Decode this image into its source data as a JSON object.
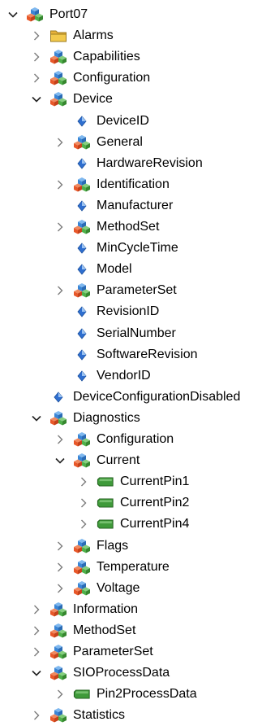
{
  "tree": {
    "rows": [
      {
        "label": "Port07",
        "depth": 0,
        "expander": "expanded",
        "icon": "object-icon"
      },
      {
        "label": "Alarms",
        "depth": 1,
        "expander": "collapsed",
        "icon": "folder-icon"
      },
      {
        "label": "Capabilities",
        "depth": 1,
        "expander": "collapsed",
        "icon": "object-icon"
      },
      {
        "label": "Configuration",
        "depth": 1,
        "expander": "collapsed",
        "icon": "object-icon"
      },
      {
        "label": "Device",
        "depth": 1,
        "expander": "expanded",
        "icon": "object-icon"
      },
      {
        "label": "DeviceID",
        "depth": 2,
        "expander": "none",
        "icon": "property-icon"
      },
      {
        "label": "General",
        "depth": 2,
        "expander": "collapsed",
        "icon": "object-icon"
      },
      {
        "label": "HardwareRevision",
        "depth": 2,
        "expander": "none",
        "icon": "property-icon"
      },
      {
        "label": "Identification",
        "depth": 2,
        "expander": "collapsed",
        "icon": "object-icon"
      },
      {
        "label": "Manufacturer",
        "depth": 2,
        "expander": "none",
        "icon": "property-icon"
      },
      {
        "label": "MethodSet",
        "depth": 2,
        "expander": "collapsed",
        "icon": "object-icon"
      },
      {
        "label": "MinCycleTime",
        "depth": 2,
        "expander": "none",
        "icon": "property-icon"
      },
      {
        "label": "Model",
        "depth": 2,
        "expander": "none",
        "icon": "property-icon"
      },
      {
        "label": "ParameterSet",
        "depth": 2,
        "expander": "collapsed",
        "icon": "object-icon"
      },
      {
        "label": "RevisionID",
        "depth": 2,
        "expander": "none",
        "icon": "property-icon"
      },
      {
        "label": "SerialNumber",
        "depth": 2,
        "expander": "none",
        "icon": "property-icon"
      },
      {
        "label": "SoftwareRevision",
        "depth": 2,
        "expander": "none",
        "icon": "property-icon"
      },
      {
        "label": "VendorID",
        "depth": 2,
        "expander": "none",
        "icon": "property-icon"
      },
      {
        "label": "DeviceConfigurationDisabled",
        "depth": 1,
        "expander": "none",
        "icon": "property-icon"
      },
      {
        "label": "Diagnostics",
        "depth": 1,
        "expander": "expanded",
        "icon": "object-icon"
      },
      {
        "label": "Configuration",
        "depth": 2,
        "expander": "collapsed",
        "icon": "object-icon"
      },
      {
        "label": "Current",
        "depth": 2,
        "expander": "expanded",
        "icon": "object-icon"
      },
      {
        "label": "CurrentPin1",
        "depth": 3,
        "expander": "collapsed",
        "icon": "variable-icon"
      },
      {
        "label": "CurrentPin2",
        "depth": 3,
        "expander": "collapsed",
        "icon": "variable-icon"
      },
      {
        "label": "CurrentPin4",
        "depth": 3,
        "expander": "collapsed",
        "icon": "variable-icon"
      },
      {
        "label": "Flags",
        "depth": 2,
        "expander": "collapsed",
        "icon": "object-icon"
      },
      {
        "label": "Temperature",
        "depth": 2,
        "expander": "collapsed",
        "icon": "object-icon"
      },
      {
        "label": "Voltage",
        "depth": 2,
        "expander": "collapsed",
        "icon": "object-icon"
      },
      {
        "label": "Information",
        "depth": 1,
        "expander": "collapsed",
        "icon": "object-icon"
      },
      {
        "label": "MethodSet",
        "depth": 1,
        "expander": "collapsed",
        "icon": "object-icon"
      },
      {
        "label": "ParameterSet",
        "depth": 1,
        "expander": "collapsed",
        "icon": "object-icon"
      },
      {
        "label": "SIOProcessData",
        "depth": 1,
        "expander": "expanded",
        "icon": "object-icon"
      },
      {
        "label": "Pin2ProcessData",
        "depth": 2,
        "expander": "collapsed",
        "icon": "variable-icon"
      },
      {
        "label": "Statistics",
        "depth": 1,
        "expander": "collapsed",
        "icon": "object-icon"
      }
    ]
  },
  "colors": {
    "object_red": "#e8582a",
    "object_green": "#4fb04a",
    "object_blue": "#3a86d6",
    "property_blue": "#2f6fd0",
    "variable_green": "#3f9a3a",
    "folder_yellow": "#f2c94c",
    "expander_gray": "#7a7a7a",
    "text": "#000000"
  }
}
